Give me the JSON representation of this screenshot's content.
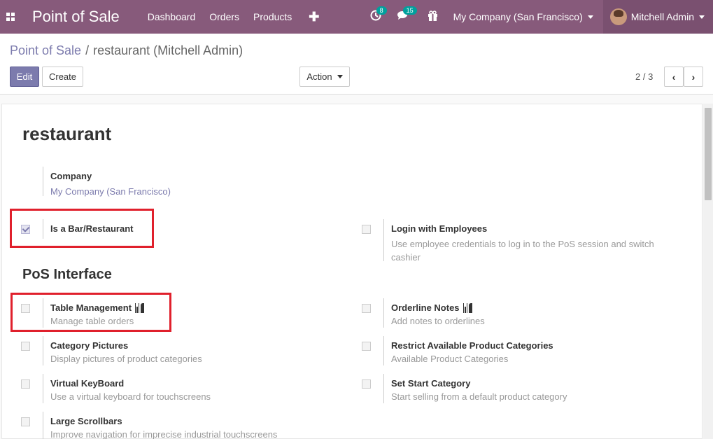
{
  "navbar": {
    "brand": "Point of Sale",
    "menu": [
      "Dashboard",
      "Orders",
      "Products"
    ],
    "activity_badge": "8",
    "messages_badge": "15",
    "company": "My Company (San Francisco)",
    "user": "Mitchell Admin",
    "bg_color": "#875a7b"
  },
  "breadcrumb": {
    "parent": "Point of Sale",
    "separator": "/",
    "current": "restaurant (Mitchell Admin)"
  },
  "toolbar": {
    "edit_label": "Edit",
    "create_label": "Create",
    "action_label": "Action",
    "pager": "2 / 3"
  },
  "record": {
    "title": "restaurant",
    "company_label": "Company",
    "company_value": "My Company (San Francisco)"
  },
  "settings": {
    "bar_restaurant": {
      "label": "Is a Bar/Restaurant",
      "checked": true
    },
    "login_employees": {
      "label": "Login with Employees",
      "desc": "Use employee credentials to log in to the PoS session and switch cashier",
      "checked": false
    },
    "section_pos_interface": "PoS Interface",
    "table_management": {
      "label": "Table Management",
      "desc": "Manage table orders",
      "checked": false
    },
    "orderline_notes": {
      "label": "Orderline Notes",
      "desc": "Add notes to orderlines",
      "checked": false
    },
    "category_pictures": {
      "label": "Category Pictures",
      "desc": "Display pictures of product categories",
      "checked": false
    },
    "restrict_categories": {
      "label": "Restrict Available Product Categories",
      "desc": "Available Product Categories",
      "checked": false
    },
    "virtual_keyboard": {
      "label": "Virtual KeyBoard",
      "desc": "Use a virtual keyboard for touchscreens",
      "checked": false
    },
    "start_category": {
      "label": "Set Start Category",
      "desc": "Start selling from a default product category",
      "checked": false
    },
    "large_scrollbars": {
      "label": "Large Scrollbars",
      "desc": "Improve navigation for imprecise industrial touchscreens",
      "checked": false
    }
  },
  "colors": {
    "accent": "#7c7bad",
    "highlight": "#e0202c"
  }
}
